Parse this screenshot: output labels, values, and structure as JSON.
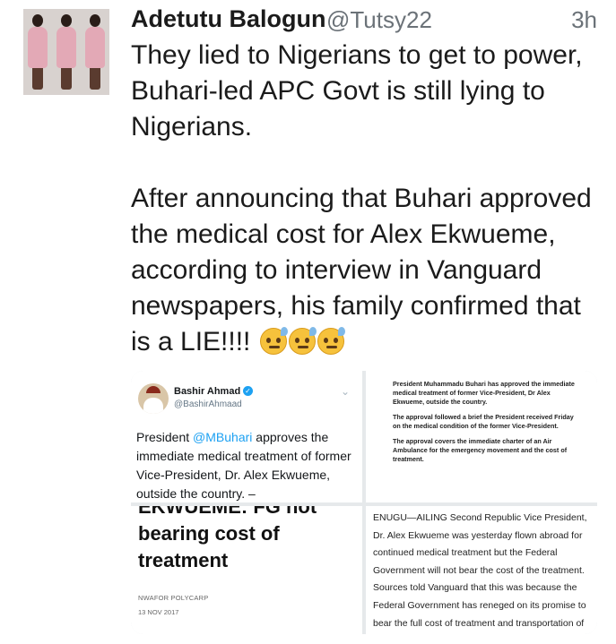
{
  "tweet": {
    "author_name": "Adetutu Balogun",
    "author_handle": "@Tutsy22",
    "time": "3h",
    "paragraph_1": "They lied to Nigerians to get to power, Buhari-led APC Govt is still lying to Nigerians.",
    "paragraph_2": "After announcing that Buhari approved the medical cost for Alex Ekwueme, according to interview in Vanguard newspapers, his family confirmed that is a LIE!!!!",
    "emojis": [
      "sweat-face-icon",
      "sweat-face-icon",
      "sweat-face-icon"
    ]
  },
  "media": {
    "embedded_tweet": {
      "name": "Bashir Ahmad",
      "handle": "@BashirAhmaad",
      "text_prefix": "President ",
      "mention": "@MBuhari",
      "text_rest": " approves the immediate medical treatment of former Vice-President, Dr. Alex Ekwueme, outside the country. –"
    },
    "document": {
      "para_1": "President Muhammadu Buhari has approved the immediate medical treatment of former Vice-President, Dr Alex Ekwueme, outside the country.",
      "para_2": "The approval followed a brief the President received Friday on the medical condition of the former Vice-President.",
      "para_3": "The approval covers the immediate charter of an Air Ambulance for the emergency movement and the cost of treatment."
    },
    "headline": {
      "title_partial": "EKWUEME: FG not",
      "title_rest": "bearing cost of treatment",
      "byline": "NWAFOR POLYCARP",
      "date": "13 NOV 2017"
    },
    "article": {
      "text": "ENUGU—AILING Second Republic Vice President, Dr. Alex Ekwueme was yesterday flown abroad for continued medical treatment but the Federal Government will not bear the cost of the treatment. Sources told Vanguard that this was because the Federal Government has reneged on its promise to bear the full cost of treatment and transportation of the elder"
    }
  }
}
